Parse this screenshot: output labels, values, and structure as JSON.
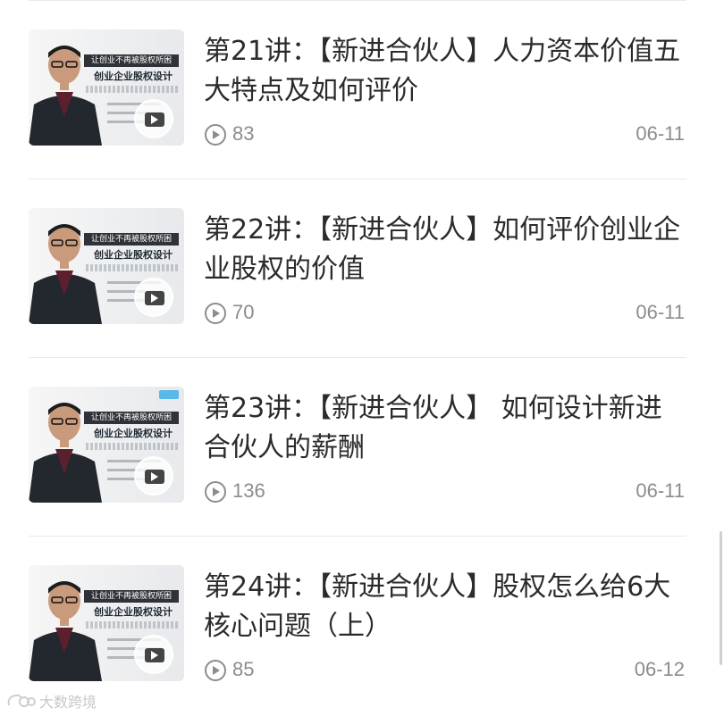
{
  "items": [
    {
      "title": "第21讲：【新进合伙人】人力资本价值五大特点及如何评价",
      "plays": "83",
      "date": "06-11",
      "thumb_banner": "让创业不再被股权所困",
      "thumb_course": "创业企业股权设计",
      "thumb_logo": false
    },
    {
      "title": "第22讲：【新进合伙人】如何评价创业企业股权的价值",
      "plays": "70",
      "date": "06-11",
      "thumb_banner": "让创业不再被股权所困",
      "thumb_course": "创业企业股权设计",
      "thumb_logo": false
    },
    {
      "title": "第23讲：【新进合伙人】 如何设计新进合伙人的薪酬",
      "plays": "136",
      "date": "06-11",
      "thumb_banner": "让创业不再被股权所困",
      "thumb_course": "创业企业股权设计",
      "thumb_logo": true
    },
    {
      "title": "第24讲：【新进合伙人】股权怎么给6大核心问题（上）",
      "plays": "85",
      "date": "06-12",
      "thumb_banner": "让创业不再被股权所困",
      "thumb_course": "创业企业股权设计",
      "thumb_logo": false
    }
  ],
  "watermark": "大数跨境",
  "icons": {
    "play_count": "play-circle-icon",
    "thumb_play": "video-play-icon",
    "watermark": "brand-logo-icon"
  },
  "colors": {
    "title": "#2b2b2b",
    "meta": "#8c8c8c",
    "divider": "#e9e9e9",
    "background": "#ffffff"
  }
}
